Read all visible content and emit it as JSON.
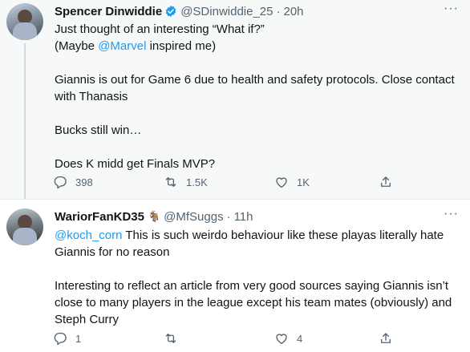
{
  "tweets": [
    {
      "name": "Spencer Dinwiddie",
      "handle": "@SDinwiddie_25",
      "time": "20h",
      "verified": true,
      "lines": {
        "l1": "Just thought of an interesting “What if?”",
        "l2a": "(Maybe ",
        "l2m": "@Marvel",
        "l2b": " inspired me)",
        "l3": "Giannis is out for Game 6 due to health and safety protocols. Close contact with Thanasis",
        "l4": "Bucks still win…",
        "l5": "Does K midd get Finals MVP?"
      },
      "replies": "398",
      "retweets": "1.5K",
      "likes": "1K"
    },
    {
      "name": "WariorFanKD35",
      "handle": "@MfSuggs",
      "time": "11h",
      "verified": false,
      "lines": {
        "l1m": "@koch_corn",
        "l1a": " This is such weirdo behaviour like these playas literally hate Giannis for no reason",
        "l2": "Interesting to reflect an article from very good sources saying Giannis isn’t close to many players in the league except his team mates (obviously) and Steph Curry"
      },
      "replies": "1",
      "retweets": "",
      "likes": "4"
    }
  ],
  "icons": {
    "verified": "verified-badge-icon",
    "goat": "goat-icon",
    "more": "more-icon",
    "reply": "reply-icon",
    "retweet": "retweet-icon",
    "like": "like-icon",
    "share": "share-icon"
  },
  "glyphs": {
    "more": "···",
    "dot": "·",
    "goat": "🐐"
  },
  "colors": {
    "link": "#1d9bf0",
    "secondary_text": "#536471"
  }
}
